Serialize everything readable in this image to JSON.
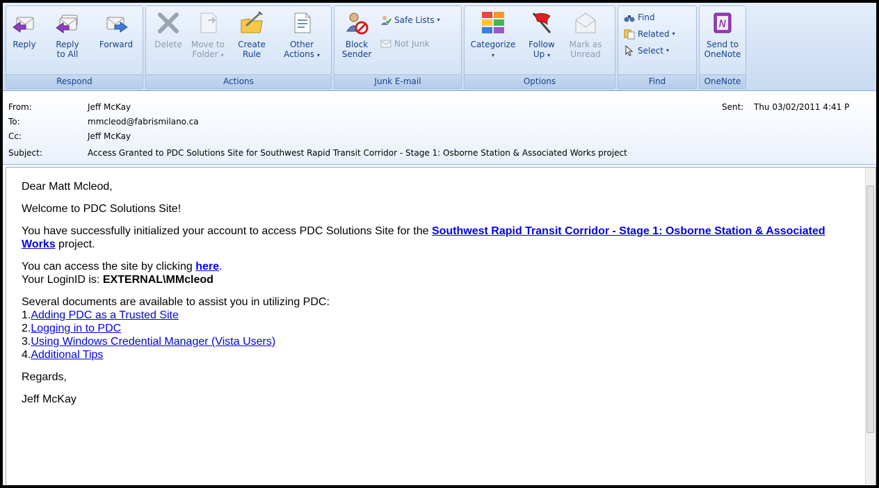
{
  "ribbon": {
    "groups": {
      "respond": "Respond",
      "actions": "Actions",
      "junk": "Junk E-mail",
      "options": "Options",
      "find": "Find",
      "onenote": "OneNote"
    },
    "reply": [
      "Reply",
      ""
    ],
    "reply_all": [
      "Reply",
      "to All"
    ],
    "forward": [
      "Forward",
      ""
    ],
    "delete": [
      "Delete",
      ""
    ],
    "move_to_folder": [
      "Move to",
      "Folder"
    ],
    "create_rule": [
      "Create",
      "Rule"
    ],
    "other_actions": [
      "Other",
      "Actions"
    ],
    "block_sender": [
      "Block",
      "Sender"
    ],
    "safe_lists": "Safe Lists",
    "not_junk": "Not Junk",
    "categorize": [
      "Categorize",
      ""
    ],
    "follow_up": [
      "Follow",
      "Up"
    ],
    "mark_unread": [
      "Mark as",
      "Unread"
    ],
    "find": "Find",
    "related": "Related",
    "select": "Select",
    "send_onenote": [
      "Send to",
      "OneNote"
    ]
  },
  "header": {
    "from_label": "From:",
    "from": "Jeff McKay",
    "to_label": "To:",
    "to": "mmcleod@fabrismilano.ca",
    "cc_label": "Cc:",
    "cc": "Jeff McKay",
    "subject_label": "Subject:",
    "subject": "Access Granted to PDC Solutions Site for Southwest Rapid Transit Corridor - Stage 1:  Osborne Station & Associated Works project",
    "sent_label": "Sent:",
    "sent": "Thu 03/02/2011 4:41 P"
  },
  "body": {
    "greeting": "Dear Matt Mcleod,",
    "welcome": "Welcome to PDC Solutions Site!",
    "init_pre": "You have successfully initialized your account to access PDC Solutions Site for the ",
    "project_link": "Southwest Rapid Transit Corridor - Stage 1: Osborne Station & Associated Works",
    "init_post": " project.",
    "access_pre": "You can access the site by clicking ",
    "access_link": "here",
    "access_post": ".",
    "login_pre": "Your LoginID is: ",
    "login_id": "EXTERNAL\\MMcleod",
    "docs_intro": "Several documents are available to assist you in utilizing PDC:",
    "docs": [
      {
        "num": "1.",
        "label": "Adding PDC as a Trusted Site"
      },
      {
        "num": "2.",
        "label": "Logging in to PDC"
      },
      {
        "num": "3.",
        "label": "Using Windows Credential Manager (Vista Users)"
      },
      {
        "num": "4.",
        "label": "Additional Tips"
      }
    ],
    "regards": "Regards,",
    "signature": "Jeff McKay"
  },
  "colors": {
    "ribbon_text": "#15428b",
    "link": "#0000ee",
    "ribbon_bg": "#d4e3f6"
  },
  "icons": [
    "reply-icon",
    "reply-all-icon",
    "forward-icon",
    "delete-icon",
    "move-to-folder-icon",
    "create-rule-icon",
    "other-actions-icon",
    "block-sender-icon",
    "safe-lists-icon",
    "not-junk-icon",
    "categorize-icon",
    "follow-up-flag-icon",
    "mark-unread-icon",
    "find-binoculars-icon",
    "related-icon",
    "select-cursor-icon",
    "onenote-icon"
  ]
}
